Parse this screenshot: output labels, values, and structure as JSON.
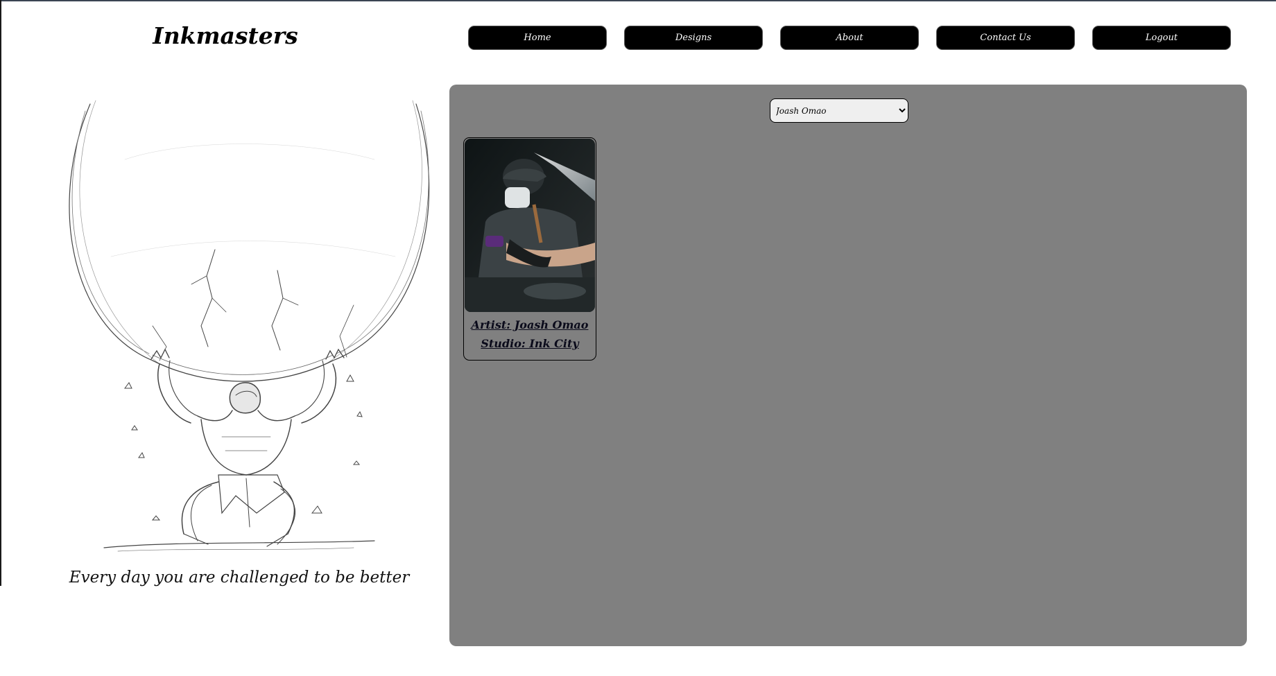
{
  "brand": "Inkmasters",
  "nav": {
    "items": [
      {
        "label": "Home"
      },
      {
        "label": "Designs"
      },
      {
        "label": "About"
      },
      {
        "label": "Contact Us"
      },
      {
        "label": "Logout"
      }
    ]
  },
  "hero": {
    "tagline": "Every day you are challenged to be better"
  },
  "artist_filter": {
    "selected": "Joash Omao",
    "options": [
      "Joash Omao"
    ]
  },
  "cards": [
    {
      "artist_label": "Artist: Joash Omao",
      "studio_label": "Studio: Ink City"
    }
  ]
}
